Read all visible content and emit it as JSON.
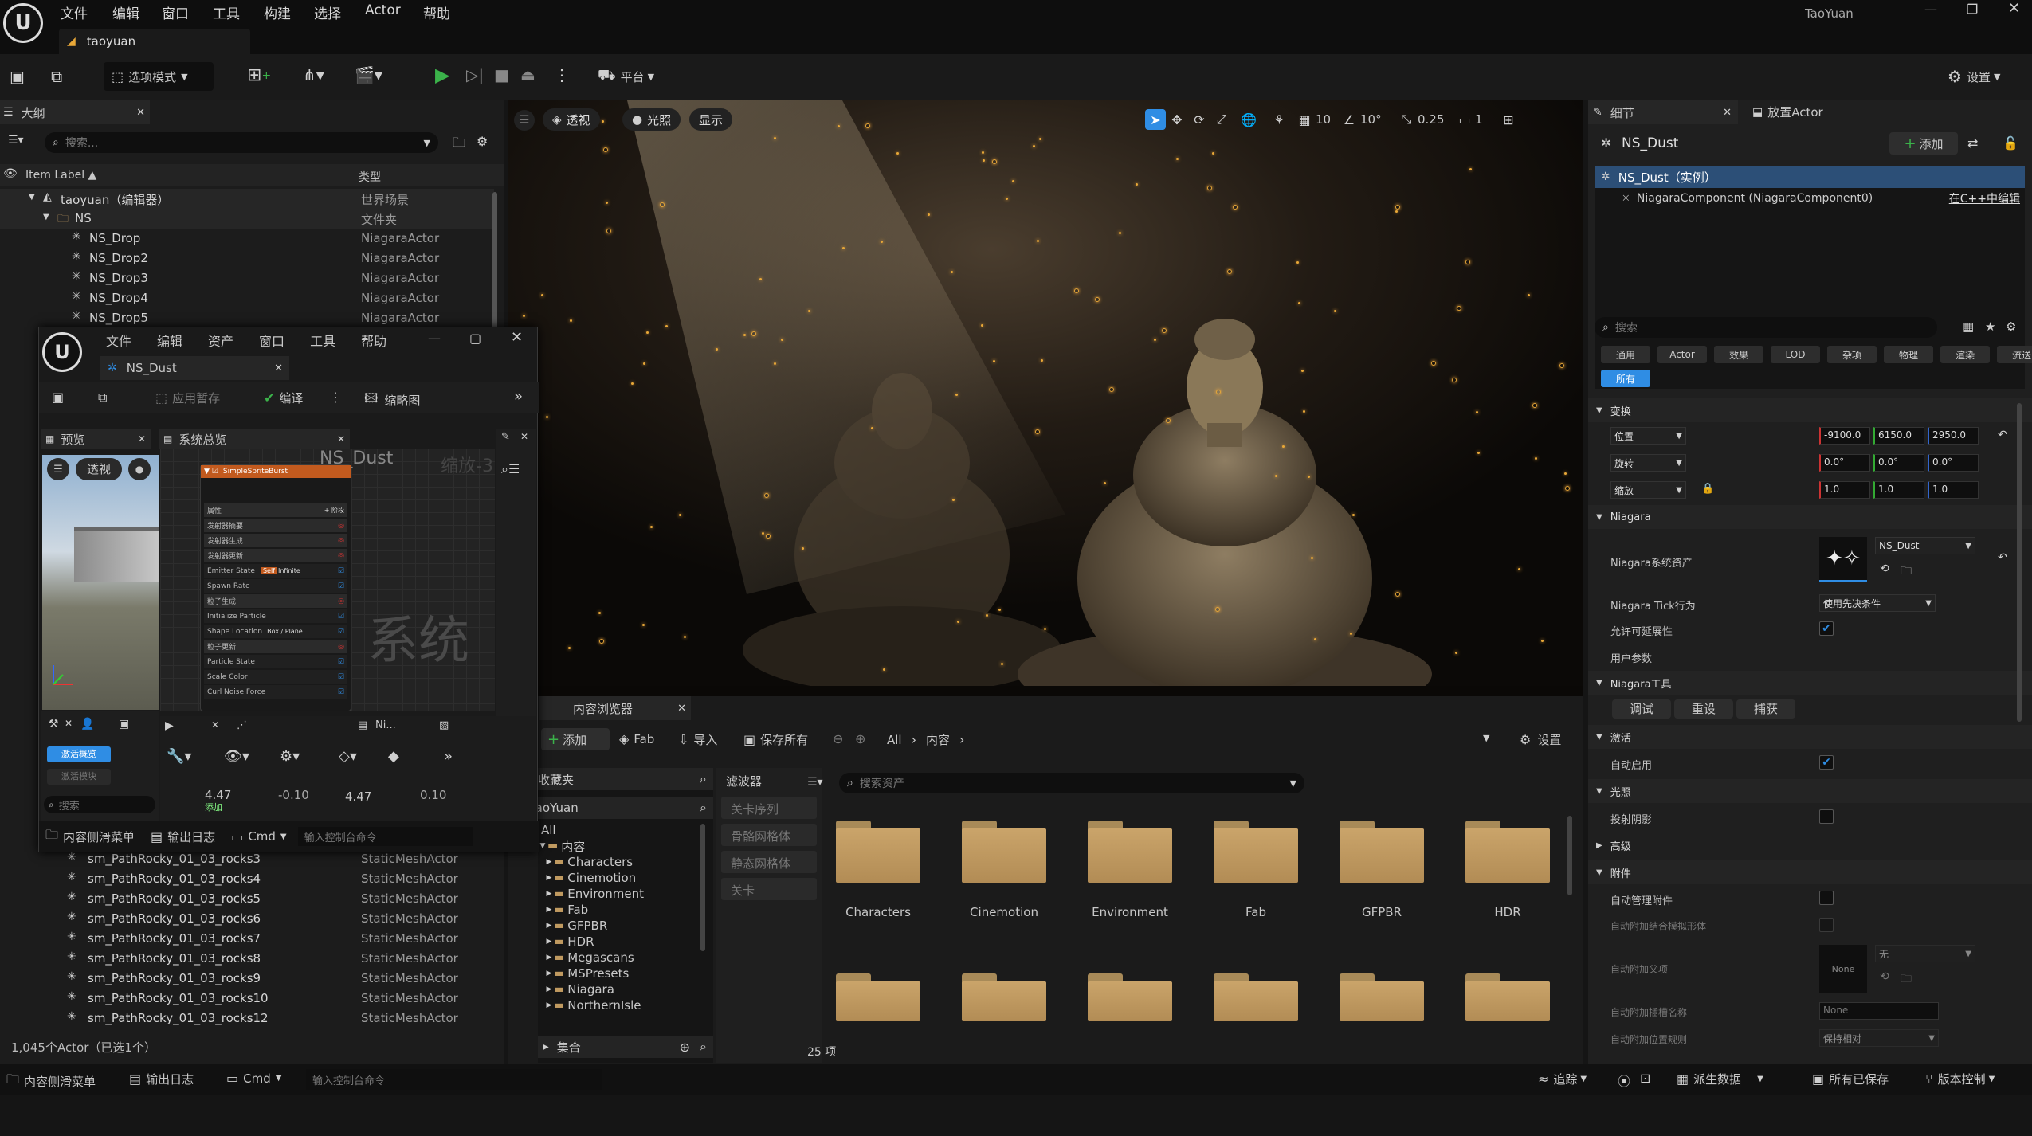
{
  "app": {
    "menu": [
      "文件",
      "编辑",
      "窗口",
      "工具",
      "构建",
      "选择",
      "Actor",
      "帮助"
    ],
    "project_tab": "taoyuan",
    "user": "TaoYuan"
  },
  "toolbar": {
    "mode_label": "选项模式",
    "platform_label": "平台",
    "settings_label": "设置"
  },
  "outliner": {
    "tab_label": "大纲",
    "search_placeholder": "搜索...",
    "col_label": "Item Label ▲",
    "col_type": "类型",
    "rows_top": [
      {
        "name": "taoyuan（编辑器）",
        "type": "世界场景",
        "indent": 0
      },
      {
        "name": "NS",
        "type": "文件夹",
        "indent": 1
      },
      {
        "name": "NS_Drop",
        "type": "NiagaraActor",
        "indent": 2
      },
      {
        "name": "NS_Drop2",
        "type": "NiagaraActor",
        "indent": 2
      },
      {
        "name": "NS_Drop3",
        "type": "NiagaraActor",
        "indent": 2
      },
      {
        "name": "NS_Drop4",
        "type": "NiagaraActor",
        "indent": 2
      },
      {
        "name": "NS_Drop5",
        "type": "NiagaraActor",
        "indent": 2
      }
    ],
    "rows_bottom": [
      {
        "name": "sm_PathRocky_01_03_rocks3",
        "type": "StaticMeshActor"
      },
      {
        "name": "sm_PathRocky_01_03_rocks4",
        "type": "StaticMeshActor"
      },
      {
        "name": "sm_PathRocky_01_03_rocks5",
        "type": "StaticMeshActor"
      },
      {
        "name": "sm_PathRocky_01_03_rocks6",
        "type": "StaticMeshActor"
      },
      {
        "name": "sm_PathRocky_01_03_rocks7",
        "type": "StaticMeshActor"
      },
      {
        "name": "sm_PathRocky_01_03_rocks8",
        "type": "StaticMeshActor"
      },
      {
        "name": "sm_PathRocky_01_03_rocks9",
        "type": "StaticMeshActor"
      },
      {
        "name": "sm_PathRocky_01_03_rocks10",
        "type": "StaticMeshActor"
      },
      {
        "name": "sm_PathRocky_01_03_rocks12",
        "type": "StaticMeshActor"
      }
    ],
    "footer": "1,045个Actor（已选1个）"
  },
  "niagara": {
    "menu": [
      "文件",
      "编辑",
      "资产",
      "窗口",
      "工具",
      "帮助"
    ],
    "tab": "NS_Dust",
    "apply_label": "应用暂存",
    "compile_label": "编译",
    "thumbnail_label": "缩略图",
    "preview_tab": "预览",
    "overview_tab": "系统总览",
    "perspective": "透视",
    "graph_title": "NS_Dust",
    "zoom": "缩放-3",
    "watermark": "系统",
    "emitter_name": "SimpleSpriteBurst",
    "stack_items": [
      "属性",
      "发射器摘要",
      "发射器生成",
      "发射器更新",
      "Emitter State",
      "Spawn Rate",
      "粒子生成",
      "Initialize Particle",
      "Shape Location",
      "粒子更新",
      "Particle State",
      "Scale Color",
      "Curl Noise Force"
    ],
    "emitter_state_tag": "Self",
    "emitter_state_value": "Infinite",
    "shape_location_value": "Box / Plane",
    "stack_add_label": "+ 阶段",
    "activate_overview": "激活概览",
    "activate_module": "激活模块",
    "search_label": "搜索",
    "timeline_tab": "Ni...",
    "tl_start": "4.47",
    "tl_a": "-0.10",
    "tl_b": "4.47",
    "tl_c": "0.10",
    "tl_add": "添加"
  },
  "viewport": {
    "perspective": "透视",
    "lighting": "光照",
    "show": "显示",
    "grid": "10",
    "angle": "10°",
    "scale": "0.25",
    "camera": "1"
  },
  "details": {
    "tab": "细节",
    "tab2": "放置Actor",
    "actor": "NS_Dust",
    "add_label": "添加",
    "instance": "NS_Dust（实例）",
    "component": "NiagaraComponent (NiagaraComponent0)",
    "edit_cpp": "在C++中编辑",
    "search_placeholder": "搜索",
    "categories": [
      "通用",
      "Actor",
      "效果",
      "LOD",
      "杂项",
      "物理",
      "渲染",
      "流送",
      "所有"
    ],
    "transform": "变换",
    "location": "位置",
    "rotation": "旋转",
    "scale": "缩放",
    "loc": [
      "-9100.0",
      "6150.0",
      "2950.0"
    ],
    "rot": [
      "0.0°",
      "0.0°",
      "0.0°"
    ],
    "scl": [
      "1.0",
      "1.0",
      "1.0"
    ],
    "niagara": "Niagara",
    "system_asset": "Niagara系统资产",
    "asset_value": "NS_Dust",
    "tick": "Niagara Tick行为",
    "tick_value": "使用先决条件",
    "scalability": "允许可延展性",
    "user_params": "用户参数",
    "tools": "Niagara工具",
    "debug": "调试",
    "reset": "重设",
    "capture": "捕获",
    "activation": "激活",
    "auto_activate": "自动启用",
    "lighting": "光照",
    "cast_shadow": "投射阴影",
    "advanced": "高级",
    "attachment": "附件",
    "auto_manage": "自动管理附件",
    "auto_weld": "自动附加结合模拟形体",
    "auto_parent": "自动附加父项",
    "none_thumb": "None",
    "none_sel": "无",
    "socket_name": "自动附加插槽名称",
    "socket_value": "None",
    "loc_rule": "自动附加位置规则",
    "loc_rule_value": "保持相对"
  },
  "content": {
    "tab": "内容浏览器",
    "add": "添加",
    "fab": "Fab",
    "import": "导入",
    "save_all": "保存所有",
    "path": [
      "All",
      "内容"
    ],
    "settings": "设置",
    "favorites": "收藏夹",
    "project": "TaoYuan",
    "tree": [
      "All",
      "内容",
      "Characters",
      "Cinemotion",
      "Environment",
      "Fab",
      "GFPBR",
      "HDR",
      "Megascans",
      "MSPresets",
      "Niagara",
      "NorthernIsle"
    ],
    "collections": "集合",
    "filters": "滤波器",
    "filter_items": [
      "关卡序列",
      "骨骼网格体",
      "静态网格体",
      "关卡"
    ],
    "search_placeholder": "搜索资产",
    "folders": [
      "Characters",
      "Cinemotion",
      "Environment",
      "Fab",
      "GFPBR",
      "HDR"
    ],
    "count": "25 项"
  },
  "statusbar": {
    "drawer": "内容侧滑菜单",
    "output": "输出日志",
    "cmd": "Cmd",
    "console_placeholder": "输入控制台命令",
    "trace": "追踪",
    "derived": "派生数据",
    "saved": "所有已保存",
    "version": "版本控制"
  },
  "colors": {
    "accent": "#2f8de4",
    "play": "#3bb24a",
    "folder": "#c09a60"
  }
}
